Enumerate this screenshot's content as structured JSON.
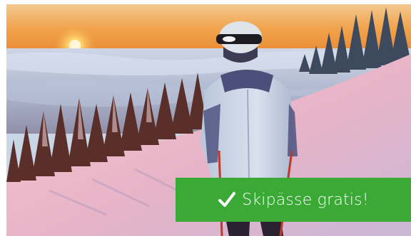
{
  "banner": {
    "photo_icon": "skier-snowy-sunset-photo",
    "cta": {
      "icon": "checkmark-icon",
      "label": "Skipässe gratis!",
      "background_color": "#3aa935",
      "text_color": "#ffffff"
    }
  }
}
